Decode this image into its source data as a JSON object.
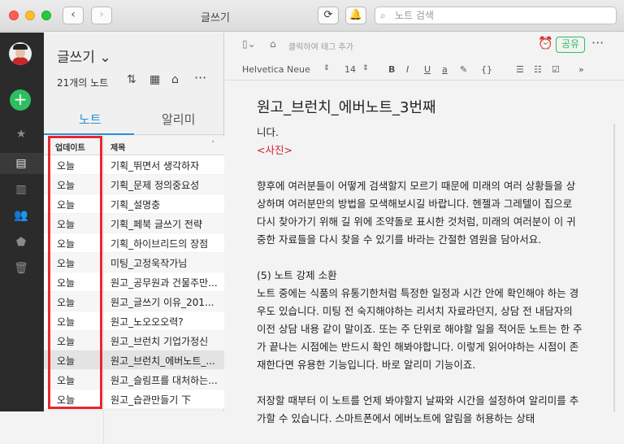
{
  "window": {
    "title": "글쓰기"
  },
  "toolbar": {
    "back": "‹",
    "forward": "›",
    "sync_icon": "sync-icon",
    "bell_icon": "bell-icon",
    "search_placeholder": "노트 검색"
  },
  "notebook": {
    "title": "글쓰기 ⌄",
    "count": "21개의 노트"
  },
  "tabs": [
    {
      "label": "노트",
      "active": true
    },
    {
      "label": "알리미",
      "active": false
    }
  ],
  "list": {
    "headers": {
      "updated": "업데이트",
      "title": "제목"
    },
    "rows": [
      {
        "date": "오늘",
        "title": "기획_뛰면서 생각하자"
      },
      {
        "date": "오늘",
        "title": "기획_문제 정의중요성"
      },
      {
        "date": "오늘",
        "title": "기획_설명충"
      },
      {
        "date": "오늘",
        "title": "기획_페북 글쓰기 전략"
      },
      {
        "date": "오늘",
        "title": "기획_하이브리드의 장점"
      },
      {
        "date": "오늘",
        "title": "미팅_고정욱작가님"
      },
      {
        "date": "오늘",
        "title": "원고_공무원과 건물주만..."
      },
      {
        "date": "오늘",
        "title": "원고_글쓰기 이유_201..."
      },
      {
        "date": "오늘",
        "title": "원고_노오오오력?"
      },
      {
        "date": "오늘",
        "title": "원고_브런치 기업가정신"
      },
      {
        "date": "오늘",
        "title": "원고_브런치_에버노트_..."
      },
      {
        "date": "오늘",
        "title": "원고_슬림프를 대처하는..."
      },
      {
        "date": "오늘",
        "title": "원고_습관만들기 下"
      }
    ]
  },
  "editor": {
    "tag_hint": "클릭하여 태그 추가",
    "share": "공유",
    "more": "···",
    "format": {
      "font": "Helvetica Neue",
      "size": "14",
      "bold": "B",
      "italic": "I",
      "underline": "U",
      "color": "a",
      "code": "{}",
      "expand": "»"
    },
    "note_title": "원고_브런치_에버노트_3번째",
    "body": [
      "니다.",
      "<사진>",
      "",
      "향후에 여러분들이 어떻게 검색할지 모르기 때문에 미래의 여러 상황들을 상상하며 여러분만의 방법을 모색해보시길 바랍니다. 헨젤과 그레텔이 집으로 다시 찾아가기 위해 길 위에 조약돌로 표시한 것처럼, 미래의 여러분이 이 귀중한 자료들을 다시 찾을 수 있기를 바라는 간절한 염원을 담아서요.",
      "",
      "(5) 노트 강제 소환",
      "노트 중에는 식품의 유통기한처럼 특정한 일정과 시간 안에 확인해야 하는 경우도 있습니다. 미팅 전 숙지해야하는 리서치 자료라던지, 상담 전 내담자의 이전 상담 내용 같이 말이죠. 또는 주 단위로 해야할 일을 적어둔 노트는 한 주가 끝나는 시점에는 반드시 확인 해봐야합니다. 이렇게 읽어야하는 시점이 존재한다면 유용한 기능입니다. 바로 알리미 기능이죠.",
      "",
      "저장할 때부터 이 노트를 언제 봐야할지 날짜와 시간을 설정하여 알리미를 추가할 수 있습니다. 스마트폰에서 에버노트에 알림을 허용하는 상태"
    ]
  }
}
